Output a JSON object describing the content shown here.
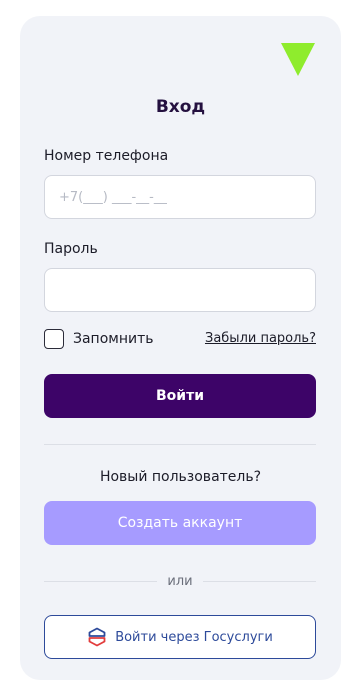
{
  "login": {
    "title": "Вход",
    "phone_label": "Номер телефона",
    "phone_placeholder": "+7(___) ___-__-__",
    "phone_value": "",
    "password_label": "Пароль",
    "password_value": "",
    "remember_label": "Запомнить",
    "remember_checked": false,
    "forgot_link": "Забыли пароль?",
    "login_button": "Войти",
    "new_user_text": "Новый пользователь?",
    "create_button": "Создать аккаунт",
    "or_text": "или",
    "gosuslugi_button": "Войти через Госуслуги"
  },
  "icons": {
    "logo": "green-triangle-logo-icon",
    "gosuslugi": "gosuslugi-logo-icon"
  },
  "colors": {
    "primary": "#3d0468",
    "secondary": "#a69bff",
    "logo": "#8fec2d",
    "gosuslugi": "#2d4a9a"
  }
}
